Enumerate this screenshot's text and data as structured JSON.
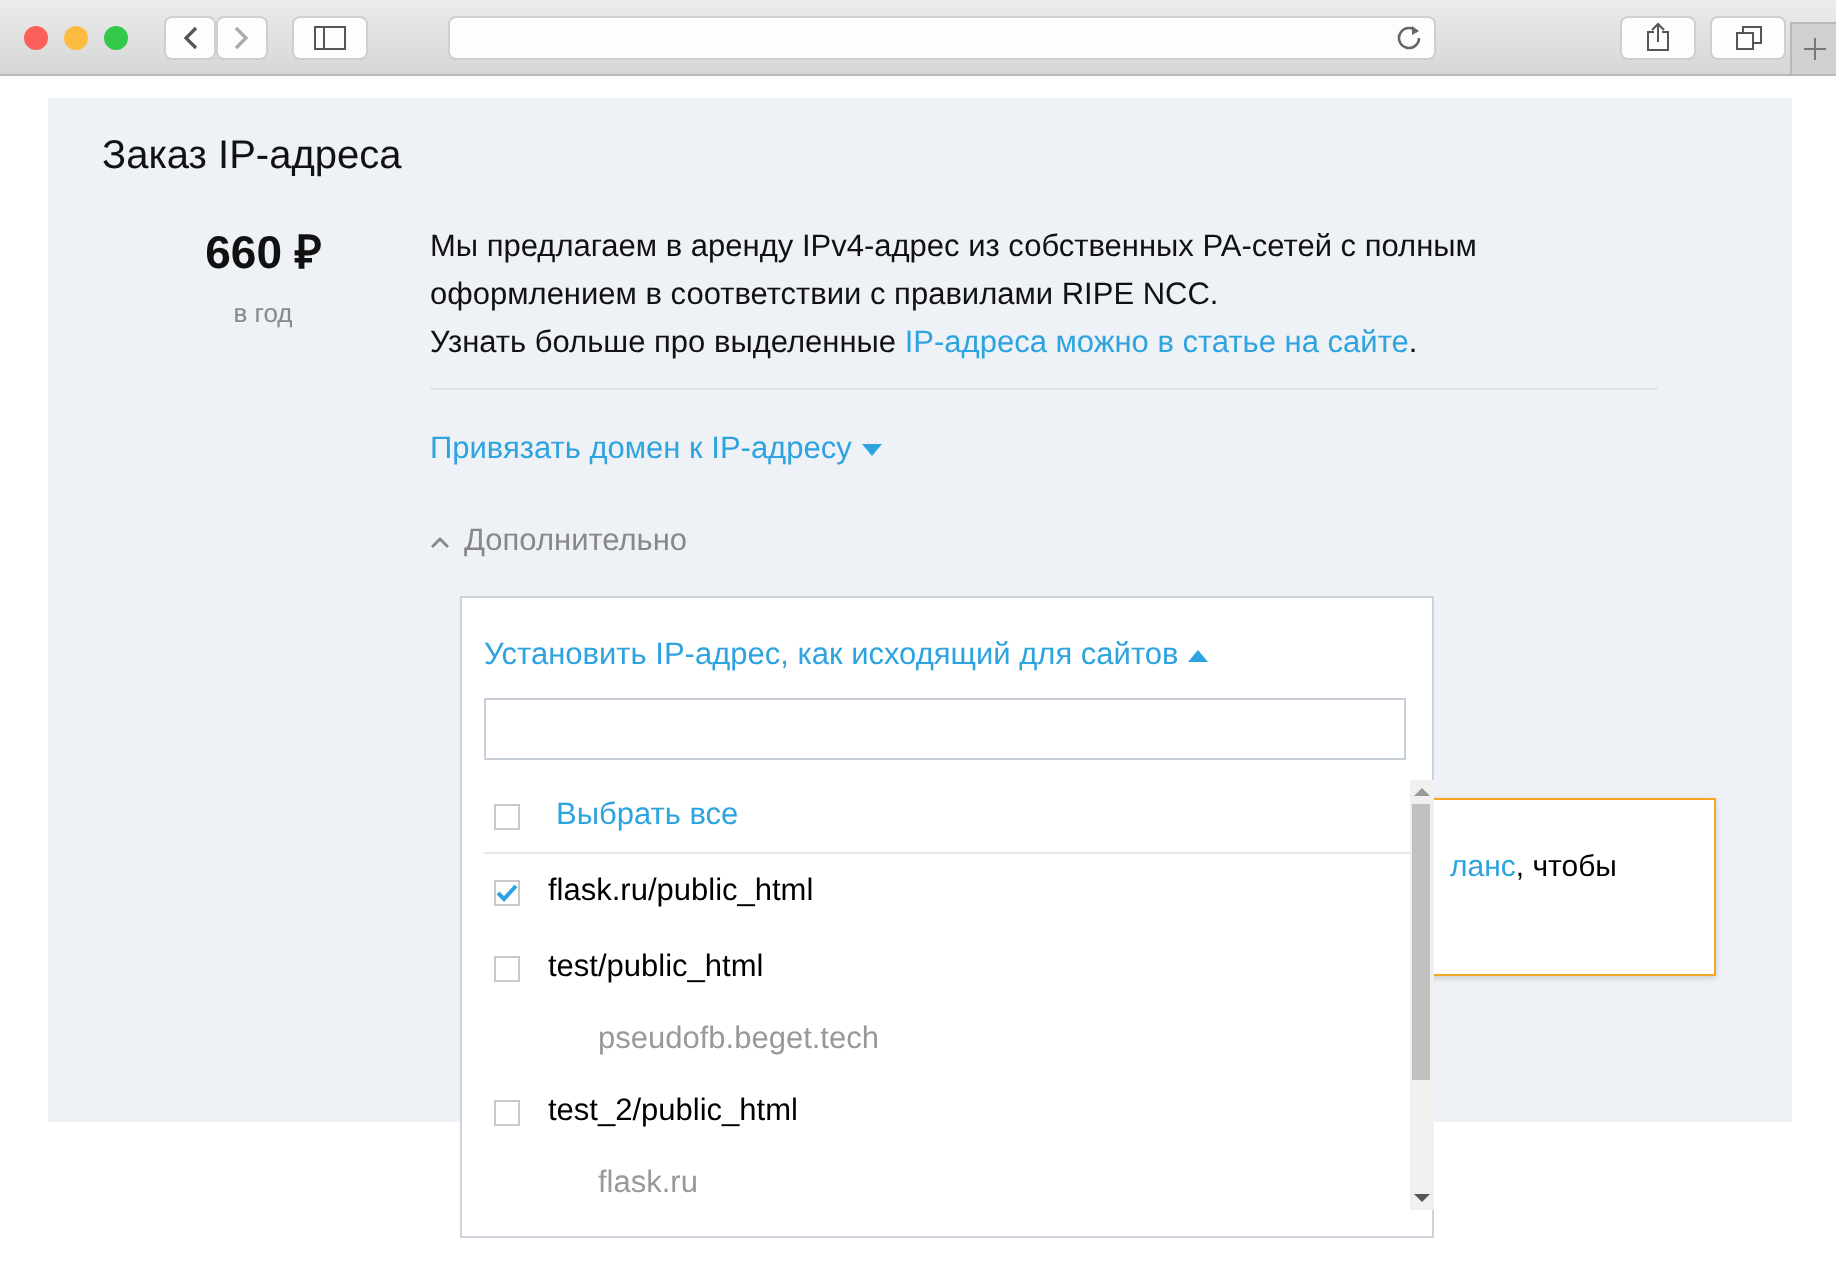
{
  "title": "Заказ IP-адреса",
  "price": {
    "amount": "660 ₽",
    "period": "в год"
  },
  "description": {
    "text": "Мы предлагаем в аренду IPv4-адрес из собственных PA-сетей с полным оформлением в соответствии с правилами RIPE NCC.",
    "more": "Узнать больше про выделенные ",
    "link": "IP-адреса можно в статье на сайте",
    "end": "."
  },
  "bind_domain": {
    "label": "Привязать домен к IP-адресу",
    "expanded": false
  },
  "advanced": {
    "label": "Дополнительно",
    "expanded": true
  },
  "notice": {
    "link": "ланс",
    "text": ", чтобы"
  },
  "dropdown": {
    "heading": "Установить IP-адрес, как исходящий для сайтов",
    "expanded": true,
    "select_all": {
      "label": "Выбрать все",
      "checked": false
    },
    "items": [
      {
        "label": "flask.ru/public_html",
        "checked": true
      },
      {
        "label": "test/public_html",
        "checked": false,
        "sub": "pseudofb.beget.tech"
      },
      {
        "label": "test_2/public_html",
        "checked": false,
        "sub": "flask.ru"
      }
    ]
  }
}
